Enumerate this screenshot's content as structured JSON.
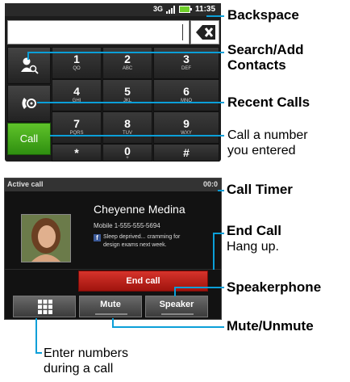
{
  "dialer": {
    "status": {
      "network": "3G",
      "time": "11:35"
    },
    "keys": [
      {
        "digit": "1",
        "letters": "QO"
      },
      {
        "digit": "2",
        "letters": "ABC"
      },
      {
        "digit": "3",
        "letters": "DEF"
      },
      {
        "digit": "4",
        "letters": "GHI"
      },
      {
        "digit": "5",
        "letters": "JKL"
      },
      {
        "digit": "6",
        "letters": "MNO"
      },
      {
        "digit": "7",
        "letters": "PQRS"
      },
      {
        "digit": "8",
        "letters": "TUV"
      },
      {
        "digit": "9",
        "letters": "WXY"
      },
      {
        "digit": "*",
        "letters": ""
      },
      {
        "digit": "0",
        "letters": "+"
      },
      {
        "digit": "#",
        "letters": ""
      }
    ],
    "call_label": "Call"
  },
  "active_call": {
    "header": "Active call",
    "timer": "00:0",
    "caller_name": "Cheyenne Medina",
    "caller_number": "Mobile 1-555-555-5694",
    "status_line1": "Sleep deprived... cramming for",
    "status_line2": "design exams next week.",
    "end_call_label": "End call",
    "mute_label": "Mute",
    "speaker_label": "Speaker"
  },
  "callouts": {
    "backspace": "Backspace",
    "search_add_line1": "Search/Add",
    "search_add_line2": "Contacts",
    "recent_calls": "Recent Calls",
    "call_number_line1": "Call a number",
    "call_number_line2": "you entered",
    "call_timer": "Call Timer",
    "end_call_title": "End Call",
    "end_call_desc": "Hang up.",
    "speakerphone": "Speakerphone",
    "mute_unmute": "Mute/Unmute",
    "enter_numbers_line1": "Enter numbers",
    "enter_numbers_line2": "during a call"
  }
}
